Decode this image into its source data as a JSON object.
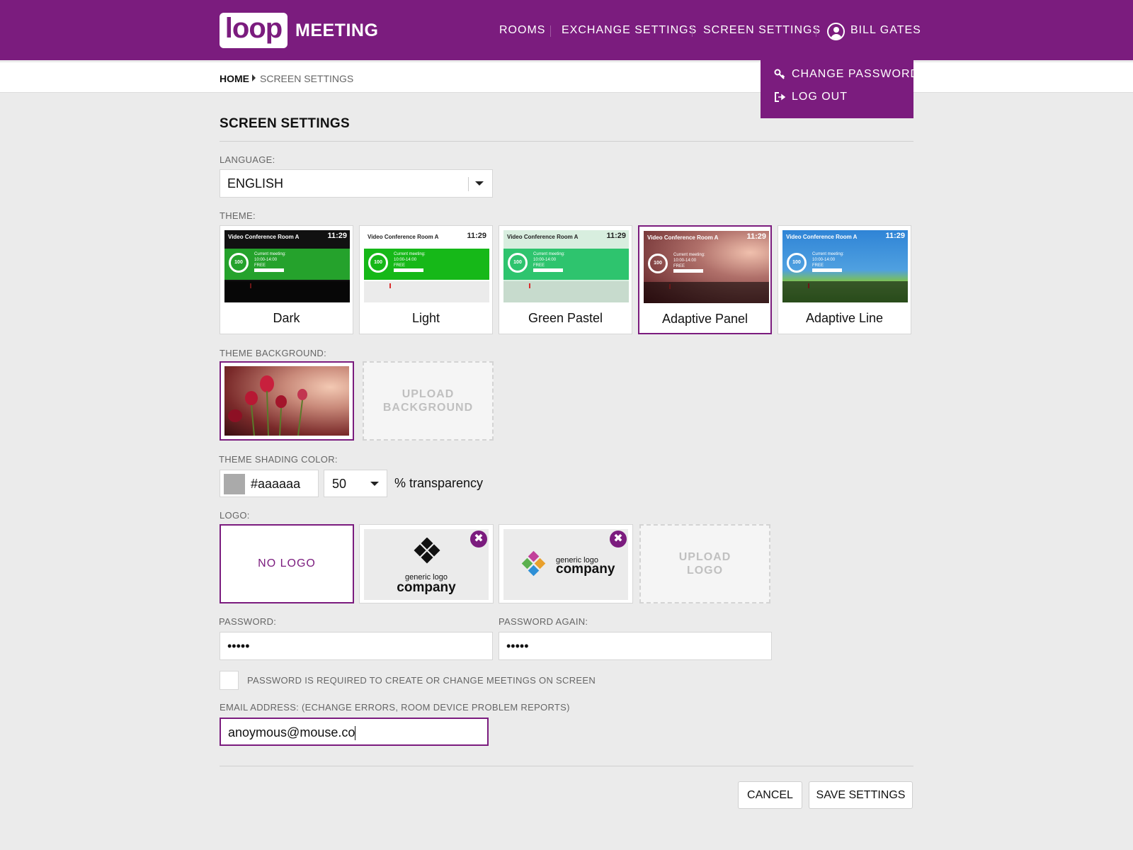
{
  "brand": {
    "logo_text": "loop",
    "product": "MEETING"
  },
  "nav": {
    "rooms": "ROOMS",
    "exchange": "EXCHANGE SETTINGS",
    "screen": "SCREEN SETTINGS",
    "user": "BILL GATES"
  },
  "user_menu": {
    "change_password": "CHANGE PASSWORD",
    "log_out": "LOG OUT"
  },
  "breadcrumb": {
    "home": "HOME",
    "current": "SCREEN SETTINGS"
  },
  "page": {
    "title": "SCREEN SETTINGS"
  },
  "language": {
    "label": "LANGUAGE:",
    "value": "ENGLISH"
  },
  "theme": {
    "label": "THEME:",
    "preview": {
      "room": "Video Conference Room A",
      "time": "11:29",
      "percent": "100",
      "current": "Current meeting:",
      "hours": "10:00-14:00",
      "status": "FREE"
    },
    "options": [
      {
        "name": "Dark",
        "selected": false,
        "bg": "#111111",
        "accent": "#25a22c"
      },
      {
        "name": "Light",
        "selected": false,
        "bg": "#ffffff",
        "accent": "#16b818"
      },
      {
        "name": "Green Pastel",
        "selected": false,
        "bg": "#d8eedf",
        "accent": "#2ec46e"
      },
      {
        "name": "Adaptive Panel",
        "selected": true,
        "bg": "#6b2a2a",
        "accent": "#16a82a"
      },
      {
        "name": "Adaptive Line",
        "selected": false,
        "bg": "#2a7fd0",
        "accent": "#2fa53a"
      }
    ]
  },
  "background": {
    "label": "THEME BACKGROUND:",
    "upload_line1": "UPLOAD",
    "upload_line2": "BACKGROUND"
  },
  "shading": {
    "label": "THEME SHADING COLOR:",
    "color": "#aaaaaa",
    "transparency": "50",
    "transparency_label": "% transparency"
  },
  "logo": {
    "label": "LOGO:",
    "no_logo": "NO LOGO",
    "company_small": "generic logo",
    "company_big": "company",
    "remove": "✖",
    "upload_line1": "UPLOAD",
    "upload_line2": "LOGO"
  },
  "password": {
    "label": "PASSWORD:",
    "value": "•••••"
  },
  "password_again": {
    "label": "PASSWORD AGAIN:",
    "value": "•••••"
  },
  "password_required": {
    "label": "PASSWORD IS REQUIRED TO CREATE OR CHANGE MEETINGS ON SCREEN",
    "checked": false
  },
  "email": {
    "label": "EMAIL ADDRESS: (ECHANGE ERRORS, ROOM DEVICE PROBLEM REPORTS)",
    "value": "anoymous@mouse.co"
  },
  "actions": {
    "cancel": "CANCEL",
    "save": "SAVE SETTINGS"
  }
}
